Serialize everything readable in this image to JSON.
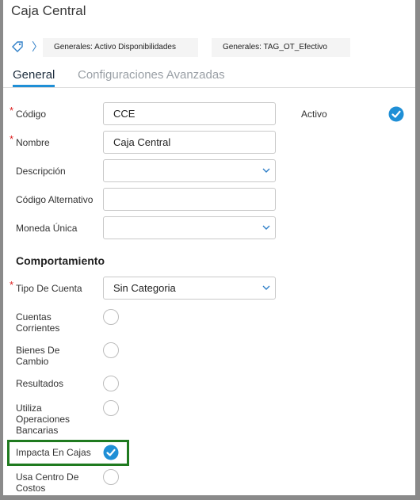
{
  "title": "Caja Central",
  "breadcrumbs": [
    "Generales: Activo Disponibilidades",
    "Generales: TAG_OT_Efectivo"
  ],
  "tabs": {
    "general": "General",
    "advanced": "Configuraciones Avanzadas"
  },
  "fields": {
    "codigo": {
      "label": "Código",
      "value": "CCE"
    },
    "nombre": {
      "label": "Nombre",
      "value": "Caja Central"
    },
    "descripcion": {
      "label": "Descripción",
      "value": ""
    },
    "codigo_alternativo": {
      "label": "Código Alternativo",
      "value": ""
    },
    "moneda_unica": {
      "label": "Moneda Única",
      "value": ""
    },
    "activo": {
      "label": "Activo",
      "checked": true
    }
  },
  "section_title": "Comportamiento",
  "tipo_cuenta": {
    "label": "Tipo De Cuenta",
    "value": "Sin Categoria"
  },
  "options": [
    {
      "label_lines": [
        "Cuentas",
        "Corrientes"
      ],
      "checked": false
    },
    {
      "label_lines": [
        "Bienes De",
        "Cambio"
      ],
      "checked": false
    },
    {
      "label_lines": [
        "Resultados"
      ],
      "checked": false
    },
    {
      "label_lines": [
        "Utiliza",
        "Operaciones",
        "Bancarias"
      ],
      "checked": false
    },
    {
      "label_lines": [
        "Impacta En Cajas"
      ],
      "checked": true
    },
    {
      "label_lines": [
        "Usa Centro De",
        "Costos"
      ],
      "checked": false
    }
  ],
  "colors": {
    "accent": "#1f8fd6",
    "required": "#dd2222",
    "highlight": "#1f7a1f"
  }
}
